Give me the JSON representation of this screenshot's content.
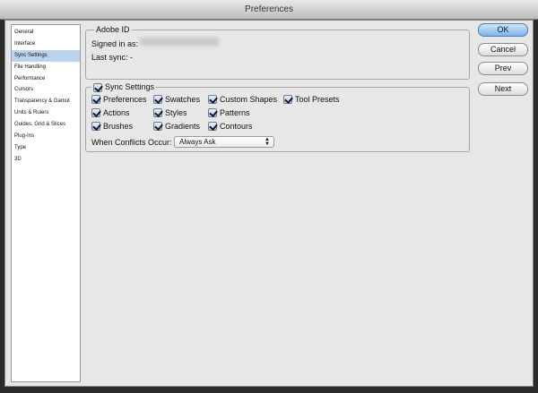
{
  "window": {
    "title": "Preferences"
  },
  "sidebar": {
    "items": [
      {
        "label": "General"
      },
      {
        "label": "Interface"
      },
      {
        "label": "Sync Settings"
      },
      {
        "label": "File Handling"
      },
      {
        "label": "Performance"
      },
      {
        "label": "Cursors"
      },
      {
        "label": "Transparency & Gamut"
      },
      {
        "label": "Units & Rulers"
      },
      {
        "label": "Guides, Grid & Slices"
      },
      {
        "label": "Plug-Ins"
      },
      {
        "label": "Type"
      },
      {
        "label": "3D"
      }
    ],
    "selected": "Sync Settings"
  },
  "adobe_id": {
    "title": "Adobe ID",
    "signed_in_label": "Signed in as:",
    "last_sync_label": "Last sync:",
    "last_sync_value": "-"
  },
  "sync_settings": {
    "title": "Sync Settings",
    "enabled": true,
    "options": {
      "preferences": {
        "label": "Preferences",
        "checked": true
      },
      "swatches": {
        "label": "Swatches",
        "checked": true
      },
      "custom_shapes": {
        "label": "Custom Shapes",
        "checked": true
      },
      "tool_presets": {
        "label": "Tool Presets",
        "checked": true
      },
      "actions": {
        "label": "Actions",
        "checked": true
      },
      "styles": {
        "label": "Styles",
        "checked": true
      },
      "patterns": {
        "label": "Patterns",
        "checked": true
      },
      "brushes": {
        "label": "Brushes",
        "checked": true
      },
      "gradients": {
        "label": "Gradients",
        "checked": true
      },
      "contours": {
        "label": "Contours",
        "checked": true
      }
    },
    "conflicts_label": "When Conflicts Occur:",
    "conflicts_value": "Always Ask"
  },
  "buttons": {
    "ok": "OK",
    "cancel": "Cancel",
    "prev": "Prev",
    "next": "Next"
  },
  "colors": {
    "selection": "#bcd3ee",
    "default_button": "#7fb2e8"
  }
}
